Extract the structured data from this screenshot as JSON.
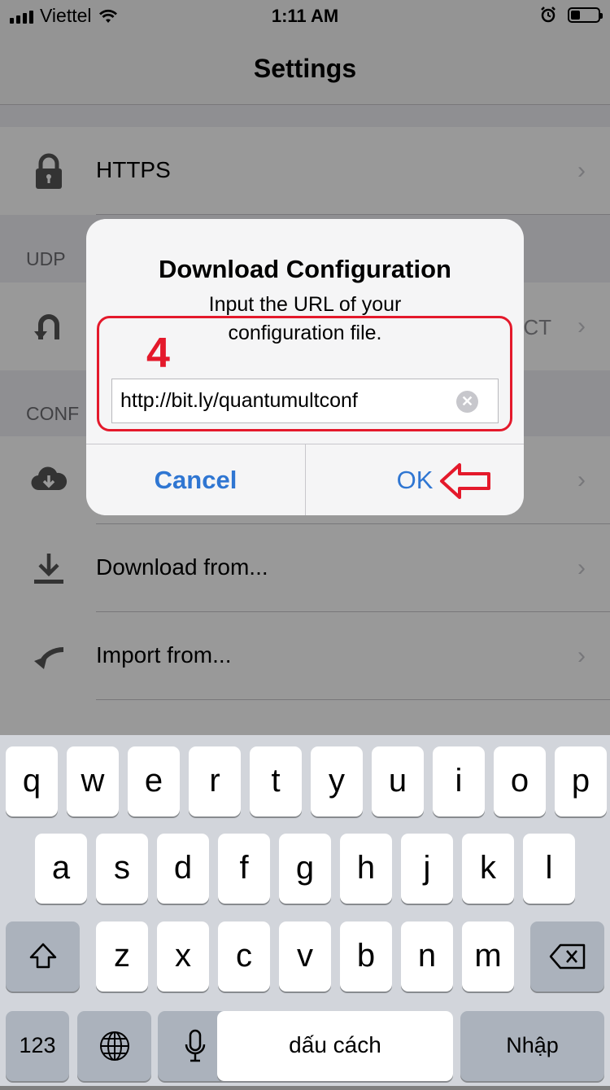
{
  "status_bar": {
    "carrier": "Viettel",
    "time": "1:11 AM",
    "battery_level": 0.35
  },
  "nav": {
    "title": "Settings"
  },
  "settings": {
    "rows": {
      "https": {
        "label": "HTTPS",
        "icon": "lock-icon"
      },
      "udp_row": {
        "trail": "CT",
        "icon": "udp-relay-icon"
      },
      "download_from": {
        "label": "Download from...",
        "icon": "download-tray-icon"
      },
      "import_from": {
        "label": "Import from...",
        "icon": "import-arrow-icon"
      }
    },
    "sections": {
      "udp": "UDP",
      "conf": "CONF"
    }
  },
  "alert": {
    "title": "Download Configuration",
    "message": "Input the URL of your configuration file.",
    "url_value": "http://bit.ly/quantumultconf",
    "cancel_label": "Cancel",
    "ok_label": "OK"
  },
  "annotation": {
    "step_number": "4",
    "color": "#e4192b"
  },
  "keyboard": {
    "row1": [
      "q",
      "w",
      "e",
      "r",
      "t",
      "y",
      "u",
      "i",
      "o",
      "p"
    ],
    "row2": [
      "a",
      "s",
      "d",
      "f",
      "g",
      "h",
      "j",
      "k",
      "l"
    ],
    "row3": [
      "z",
      "x",
      "c",
      "v",
      "b",
      "n",
      "m"
    ],
    "numbers_label": "123",
    "space_label": "dấu cách",
    "return_label": "Nhập"
  },
  "colors": {
    "accent": "#2f76d2"
  }
}
